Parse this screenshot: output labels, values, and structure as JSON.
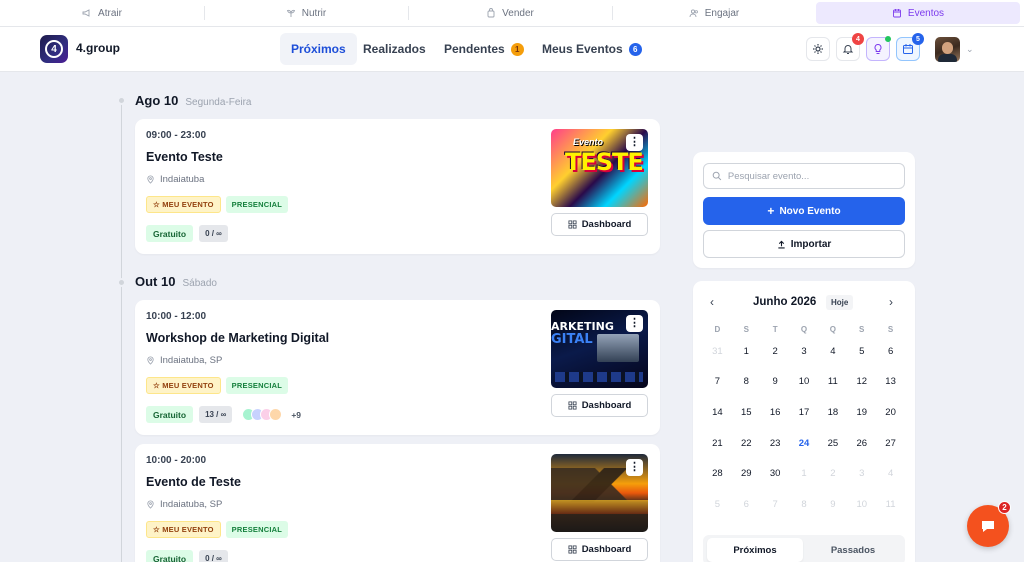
{
  "modules": [
    {
      "label": "Atrair",
      "icon": "megaphone-icon",
      "active": false
    },
    {
      "label": "Nutrir",
      "icon": "seedling-icon",
      "active": false
    },
    {
      "label": "Vender",
      "icon": "shopping-bag-icon",
      "active": false
    },
    {
      "label": "Engajar",
      "icon": "users-icon",
      "active": false
    },
    {
      "label": "Eventos",
      "icon": "calendar-icon",
      "active": true
    }
  ],
  "header": {
    "brand": "4.group",
    "logo_text": "4",
    "tabs": [
      {
        "label": "Próximos",
        "active": true,
        "count": null
      },
      {
        "label": "Realizados",
        "active": false,
        "count": null
      },
      {
        "label": "Pendentes",
        "active": false,
        "count": "1"
      },
      {
        "label": "Meus Eventos",
        "active": false,
        "count": "6"
      }
    ],
    "notifications_count": "4",
    "calendar_count": "5"
  },
  "days": [
    {
      "date": "Ago 10",
      "weekday": "Segunda-Feira"
    },
    {
      "date": "Out 10",
      "weekday": "Sábado"
    }
  ],
  "events": [
    {
      "time": "09:00 - 23:00",
      "title": "Evento Teste",
      "location": "Indaiatuba",
      "tags": [
        "☆ MEU EVENTO",
        "PRESENCIAL"
      ],
      "price": "Gratuito",
      "attendance": "0 / ∞",
      "more_attendees": "",
      "thumb_text_1": "Evento",
      "thumb_text_2": "TESTE",
      "dashboard_label": "Dashboard"
    },
    {
      "time": "10:00 - 12:00",
      "title": "Workshop de Marketing Digital",
      "location": "Indaiatuba, SP",
      "tags": [
        "☆ MEU EVENTO",
        "PRESENCIAL"
      ],
      "price": "Gratuito",
      "attendance": "13 / ∞",
      "more_attendees": "+9",
      "thumb_text_1": "ARKETING",
      "thumb_text_2": "GITAL",
      "dashboard_label": "Dashboard"
    },
    {
      "time": "10:00 - 20:00",
      "title": "Evento de Teste",
      "location": "Indaiatuba, SP",
      "tags": [
        "☆ MEU EVENTO",
        "PRESENCIAL"
      ],
      "price": "Gratuito",
      "attendance": "0 / ∞",
      "more_attendees": "",
      "dashboard_label": "Dashboard"
    }
  ],
  "attendee_colors": [
    "#a7f3d0",
    "#c7d2fe",
    "#fbcfe8",
    "#fed7aa"
  ],
  "sidebar": {
    "search_placeholder": "Pesquisar evento...",
    "new_event_label": "Novo Evento",
    "import_label": "Importar"
  },
  "calendar": {
    "month": "Junho 2026",
    "today_label": "Hoje",
    "weekdays": [
      "D",
      "S",
      "T",
      "Q",
      "Q",
      "S",
      "S"
    ],
    "today": "24",
    "weeks": [
      [
        "31",
        "1",
        "2",
        "3",
        "4",
        "5",
        "6"
      ],
      [
        "7",
        "8",
        "9",
        "10",
        "11",
        "12",
        "13"
      ],
      [
        "14",
        "15",
        "16",
        "17",
        "18",
        "19",
        "20"
      ],
      [
        "21",
        "22",
        "23",
        "24",
        "25",
        "26",
        "27"
      ],
      [
        "28",
        "29",
        "30",
        "1",
        "2",
        "3",
        "4"
      ],
      [
        "5",
        "6",
        "7",
        "8",
        "9",
        "10",
        "11"
      ]
    ],
    "segments": [
      "Próximos",
      "Passados"
    ]
  },
  "chat": {
    "badge": "2"
  },
  "colors": {
    "accent": "#2563eb",
    "module_active": "#7c3aed",
    "fab": "#f4511e"
  }
}
